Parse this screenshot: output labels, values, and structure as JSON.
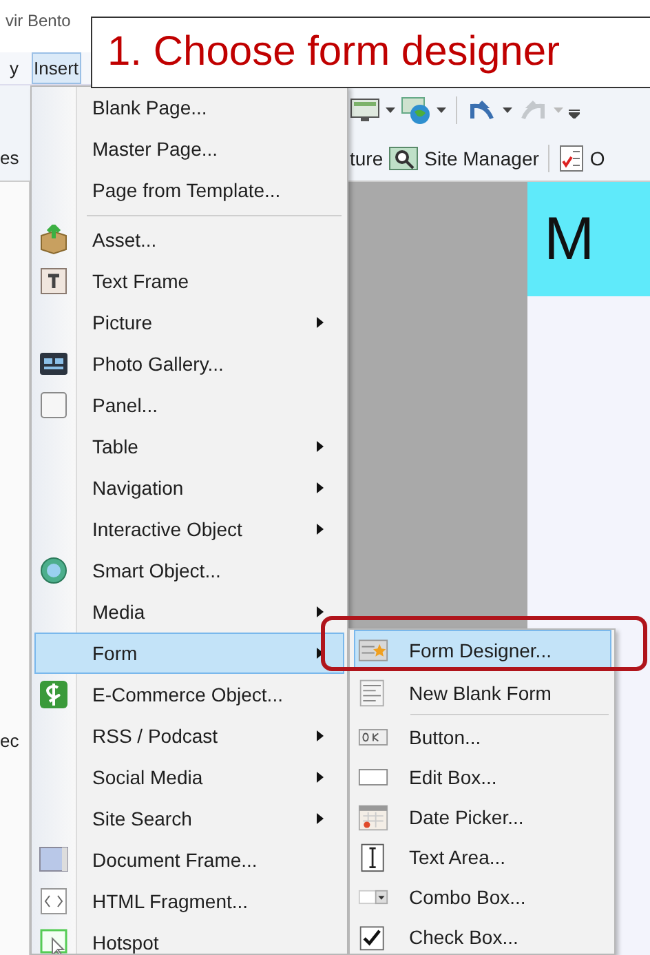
{
  "app": {
    "title": "vir Bento",
    "menubar": [
      {
        "label": "y",
        "selected": false
      },
      {
        "label": "Insert",
        "selected": true
      }
    ],
    "toolbar": [
      {
        "kind": "text",
        "label": "ture"
      },
      {
        "kind": "site-manager",
        "label": "Site Manager"
      },
      {
        "kind": "checklist",
        "label": "O"
      }
    ],
    "side_labels": [
      "es",
      "ec"
    ],
    "canvas_heading": "M"
  },
  "callout": {
    "text": "1. Choose form designer"
  },
  "insert_menu": {
    "items": [
      {
        "kind": "plain",
        "label": "Blank Page...",
        "submenu": false,
        "selected": false
      },
      {
        "kind": "plain",
        "label": "Master Page...",
        "submenu": false,
        "selected": false
      },
      {
        "kind": "plain",
        "label": "Page from Template...",
        "submenu": false,
        "selected": false
      },
      {
        "kind": "separator"
      },
      {
        "kind": "box",
        "label": "Asset...",
        "submenu": false,
        "selected": false
      },
      {
        "kind": "text-frame",
        "label": "Text Frame",
        "submenu": false,
        "selected": false
      },
      {
        "kind": "plain",
        "label": "Picture",
        "submenu": true,
        "selected": false
      },
      {
        "kind": "gallery",
        "label": "Photo Gallery...",
        "submenu": false,
        "selected": false
      },
      {
        "kind": "panel",
        "label": "Panel...",
        "submenu": false,
        "selected": false
      },
      {
        "kind": "plain",
        "label": "Table",
        "submenu": true,
        "selected": false
      },
      {
        "kind": "plain",
        "label": "Navigation",
        "submenu": true,
        "selected": false
      },
      {
        "kind": "plain",
        "label": "Interactive Object",
        "submenu": true,
        "selected": false
      },
      {
        "kind": "globe",
        "label": "Smart Object...",
        "submenu": false,
        "selected": false
      },
      {
        "kind": "plain",
        "label": "Media",
        "submenu": true,
        "selected": false
      },
      {
        "kind": "plain",
        "label": "Form",
        "submenu": true,
        "selected": true
      },
      {
        "kind": "dollar",
        "label": "E-Commerce Object...",
        "submenu": false,
        "selected": false
      },
      {
        "kind": "plain",
        "label": "RSS / Podcast",
        "submenu": true,
        "selected": false
      },
      {
        "kind": "plain",
        "label": "Social Media",
        "submenu": true,
        "selected": false
      },
      {
        "kind": "plain",
        "label": "Site Search",
        "submenu": true,
        "selected": false
      },
      {
        "kind": "document",
        "label": "Document Frame...",
        "submenu": false,
        "selected": false
      },
      {
        "kind": "html",
        "label": "HTML Fragment...",
        "submenu": false,
        "selected": false
      },
      {
        "kind": "hotspot",
        "label": "Hotspot",
        "submenu": false,
        "selected": false
      }
    ]
  },
  "form_submenu": {
    "items": [
      {
        "kind": "form-star",
        "label": "Form Designer...",
        "selected": true
      },
      {
        "kind": "form-lines",
        "label": "New Blank Form",
        "selected": false
      },
      {
        "kind": "separator"
      },
      {
        "kind": "ok",
        "label": "Button...",
        "selected": false
      },
      {
        "kind": "edit",
        "label": "Edit Box...",
        "selected": false
      },
      {
        "kind": "calendar",
        "label": "Date Picker...",
        "selected": false
      },
      {
        "kind": "text-area",
        "label": "Text Area...",
        "selected": false
      },
      {
        "kind": "combo",
        "label": "Combo Box...",
        "selected": false
      },
      {
        "kind": "check",
        "label": "Check Box...",
        "selected": false
      }
    ]
  }
}
